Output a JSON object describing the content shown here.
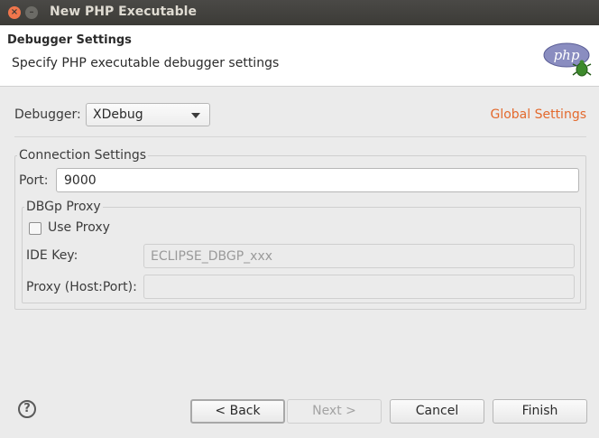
{
  "window": {
    "title": "New PHP Executable",
    "close_glyph": "×",
    "min_glyph": "–"
  },
  "header": {
    "title": "Debugger Settings",
    "description": "Specify PHP executable debugger settings",
    "logo_text": "php"
  },
  "debugger": {
    "label": "Debugger:",
    "selected": "XDebug",
    "global_settings_link": "Global Settings"
  },
  "connection": {
    "legend": "Connection Settings",
    "port_label": "Port:",
    "port_value": "9000"
  },
  "dbgp_proxy": {
    "legend": "DBGp Proxy",
    "use_proxy_label": "Use Proxy",
    "use_proxy_checked": false,
    "ide_key_label": "IDE Key:",
    "ide_key_value": "ECLIPSE_DBGP_xxx",
    "proxy_label": "Proxy (Host:Port):",
    "proxy_value": ""
  },
  "buttons": {
    "help": "?",
    "back": "< Back",
    "next": "Next >",
    "cancel": "Cancel",
    "finish": "Finish"
  },
  "colors": {
    "link": "#e36a2e",
    "titlebar": "#3c3b37",
    "close_button": "#f0764c"
  }
}
